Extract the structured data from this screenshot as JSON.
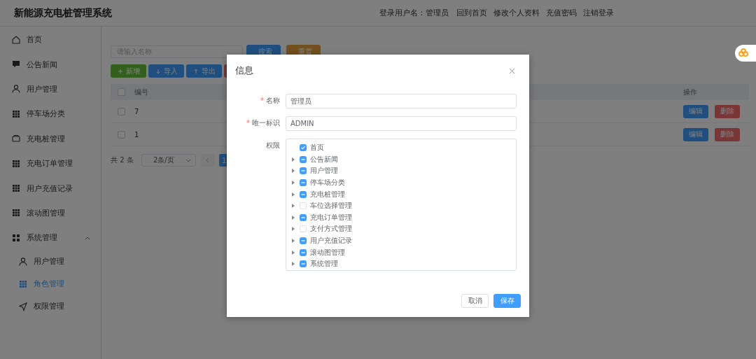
{
  "header": {
    "title": "新能源充电桩管理系统",
    "user_label": "登录用户名：管理员",
    "links": [
      "回到首页",
      "修改个人资料",
      "充值密码",
      "注销登录"
    ]
  },
  "sidebar": {
    "items": [
      {
        "label": "首页",
        "selected": false
      },
      {
        "label": "公告新闻",
        "selected": false
      },
      {
        "label": "用户管理",
        "selected": false
      },
      {
        "label": "停车场分类",
        "selected": false
      },
      {
        "label": "充电桩管理",
        "selected": false
      },
      {
        "label": "充电订单管理",
        "selected": false
      },
      {
        "label": "用户充值记录",
        "selected": false
      },
      {
        "label": "滚动图管理",
        "selected": false
      },
      {
        "label": "系统管理",
        "selected": false,
        "expanded": true,
        "children": [
          {
            "label": "用户管理",
            "selected": false
          },
          {
            "label": "角色管理",
            "selected": true
          },
          {
            "label": "权限管理",
            "selected": false
          }
        ]
      }
    ]
  },
  "search": {
    "placeholder": "请输入名称",
    "buttons": [
      {
        "label": "搜索",
        "kind": "primary"
      },
      {
        "label": "重置",
        "kind": "warning"
      }
    ]
  },
  "toolbar": [
    {
      "label": "新增",
      "kind": "success"
    },
    {
      "label": "导入",
      "kind": "primary"
    },
    {
      "label": "导出",
      "kind": "primary"
    },
    {
      "kind": "danger"
    }
  ],
  "table": {
    "all_selected": false,
    "columns": [
      "编号",
      "操作"
    ],
    "rows": [
      {
        "id": "7",
        "selected": false,
        "actions": [
          "编辑",
          "删除"
        ]
      },
      {
        "id": "1",
        "selected": false,
        "actions": [
          "编辑",
          "删除"
        ]
      }
    ]
  },
  "pagination": {
    "total": "共 2 条",
    "page_size": "2条/页",
    "page": "1"
  },
  "dialog": {
    "title": "信息",
    "fields": [
      {
        "label": "名称",
        "required": true,
        "required_mark": "*",
        "value": "管理员"
      },
      {
        "label": "唯一标识",
        "required": true,
        "required_mark": "*",
        "value": "ADMIN"
      }
    ],
    "permissions": {
      "label": "权限",
      "tree": [
        {
          "label": "首页",
          "checked": true,
          "indeterminate": false,
          "expandable": false
        },
        {
          "label": "公告新闻",
          "checked": false,
          "indeterminate": true,
          "expandable": true
        },
        {
          "label": "用户管理",
          "checked": false,
          "indeterminate": true,
          "expandable": true
        },
        {
          "label": "停车场分类",
          "checked": false,
          "indeterminate": true,
          "expandable": true
        },
        {
          "label": "充电桩管理",
          "checked": false,
          "indeterminate": true,
          "expandable": true
        },
        {
          "label": "车位选择管理",
          "checked": false,
          "indeterminate": false,
          "expandable": true
        },
        {
          "label": "充电订单管理",
          "checked": false,
          "indeterminate": true,
          "expandable": true
        },
        {
          "label": "支付方式管理",
          "checked": false,
          "indeterminate": false,
          "expandable": true
        },
        {
          "label": "用户充值记录",
          "checked": false,
          "indeterminate": true,
          "expandable": true
        },
        {
          "label": "滚动图管理",
          "checked": false,
          "indeterminate": true,
          "expandable": true
        },
        {
          "label": "系统管理",
          "checked": false,
          "indeterminate": true,
          "expandable": true
        }
      ]
    },
    "buttons": [
      {
        "label": "取消",
        "kind": "default"
      },
      {
        "label": "保存",
        "kind": "primary"
      }
    ]
  }
}
